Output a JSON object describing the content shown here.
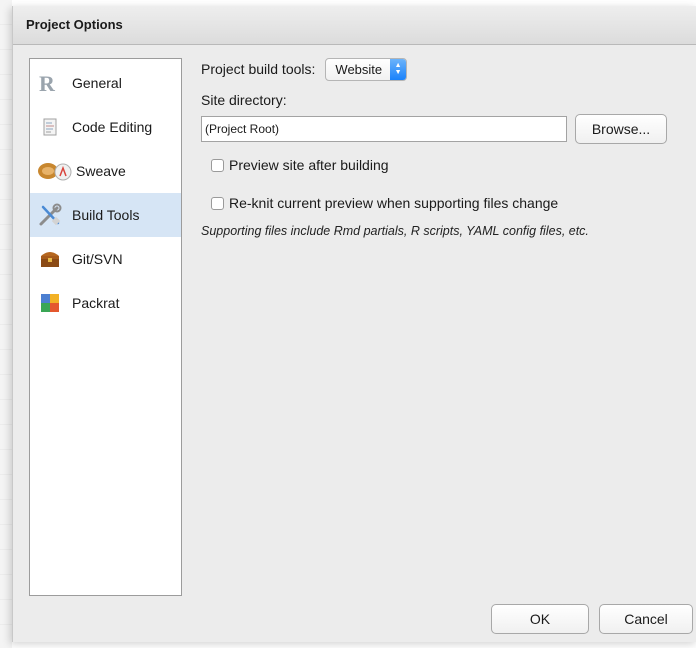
{
  "window": {
    "title": "Project Options"
  },
  "sidebar": {
    "items": [
      {
        "label": "General",
        "icon": "r-logo-icon",
        "active": false
      },
      {
        "label": "Code Editing",
        "icon": "document-icon",
        "active": false
      },
      {
        "label": "Sweave",
        "icon": "sweave-pdf-icon",
        "active": false
      },
      {
        "label": "Build Tools",
        "icon": "wrench-screwdriver-icon",
        "active": true
      },
      {
        "label": "Git/SVN",
        "icon": "treasure-box-icon",
        "active": false
      },
      {
        "label": "Packrat",
        "icon": "packrat-icon",
        "active": false
      }
    ]
  },
  "build": {
    "tools_label": "Project build tools:",
    "tools_value": "Website",
    "site_dir_label": "Site directory:",
    "site_dir_value": "(Project Root)",
    "browse_label": "Browse...",
    "preview_label": "Preview site after building",
    "preview_checked": false,
    "reknit_label": "Re-knit current preview when supporting files change",
    "reknit_checked": false,
    "note": "Supporting files include Rmd partials, R scripts, YAML config files, etc."
  },
  "footer": {
    "ok_label": "OK",
    "cancel_label": "Cancel"
  },
  "colors": {
    "active_item": "#d6e5f5",
    "select_arrow": "#1a82fb",
    "dialog_bg": "#ececec"
  }
}
